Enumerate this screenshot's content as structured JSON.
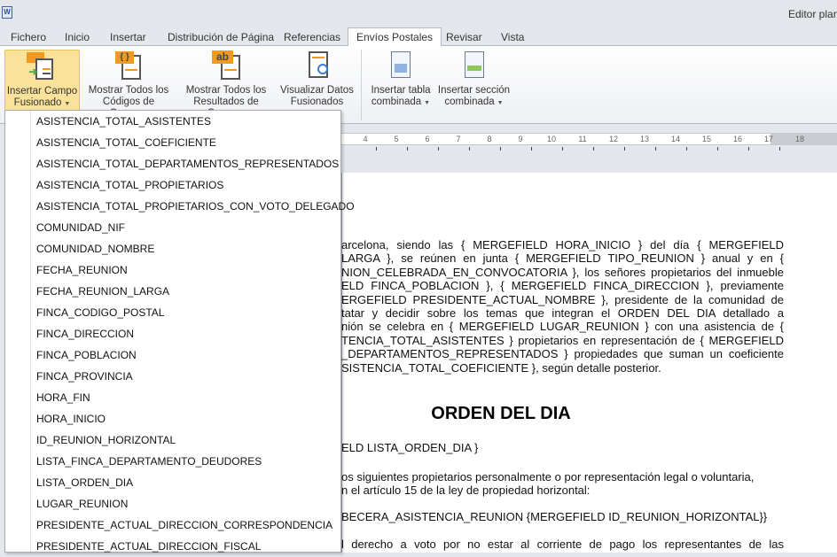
{
  "window": {
    "title": "Editor plant"
  },
  "tabs": [
    "Fichero",
    "Inicio",
    "Insertar",
    "Distribución de Página",
    "Referencias",
    "Envíos Postales",
    "Revisar",
    "Vista"
  ],
  "active_tab": "Envíos Postales",
  "ribbon": {
    "insert_field": {
      "line1": "Insertar Campo",
      "line2": "Fusionado"
    },
    "show_codes": {
      "line1": "Mostrar Todos los",
      "line2": "Códigos de Campos"
    },
    "show_results": {
      "line1": "Mostrar Todos los",
      "line2": "Resultados de Campos"
    },
    "preview": {
      "line1": "Visualizar Datos",
      "line2": "Fusionados"
    },
    "insert_table": {
      "line1": "Insertar tabla",
      "line2": "combinada"
    },
    "insert_section": {
      "line1": "Insertar sección",
      "line2": "combinada"
    },
    "icon_labels": {
      "codes": "{ }",
      "results": "ab"
    }
  },
  "ruler": {
    "numbers": [
      "4",
      "5",
      "6",
      "7",
      "8",
      "9",
      "10",
      "11",
      "12",
      "13",
      "14",
      "15",
      "16",
      "17",
      "18"
    ]
  },
  "merge_fields": [
    "ASISTENCIA_TOTAL_ASISTENTES",
    "ASISTENCIA_TOTAL_COEFICIENTE",
    "ASISTENCIA_TOTAL_DEPARTAMENTOS_REPRESENTADOS",
    "ASISTENCIA_TOTAL_PROPIETARIOS",
    "ASISTENCIA_TOTAL_PROPIETARIOS_CON_VOTO_DELEGADO",
    "COMUNIDAD_NIF",
    "COMUNIDAD_NOMBRE",
    "FECHA_REUNION",
    "FECHA_REUNION_LARGA",
    "FINCA_CODIGO_POSTAL",
    "FINCA_DIRECCION",
    "FINCA_POBLACION",
    "FINCA_PROVINCIA",
    "HORA_FIN",
    "HORA_INICIO",
    "ID_REUNION_HORIZONTAL",
    "LISTA_FINCA_DEPARTAMENTO_DEUDORES",
    "LISTA_ORDEN_DIA",
    "LUGAR_REUNION",
    "PRESIDENTE_ACTUAL_DIRECCION_CORRESPONDENCIA",
    "PRESIDENTE_ACTUAL_DIRECCION_FISCAL"
  ],
  "document": {
    "paragraph1": [
      "arcelona,  siendo  las  {  MERGEFIELD  HORA_INICIO  }  del  día  {  MERGEFIELD",
      "LARGA }, se reúnen en junta { MERGEFIELD TIPO_REUNION } anual y en {",
      "NION_CELEBRADA_EN_CONVOCATORIA }, los señores propietarios del inmueble",
      "ELD FINCA_POBLACION }, { MERGEFIELD FINCA_DIRECCION }, previamente",
      "ERGEFIELD PRESIDENTE_ACTUAL_NOMBRE }, presidente de la comunidad de",
      "tatar y decidir sobre los temas que integran el ORDEN DEL DIA detallado a",
      "nión se celebra en { MERGEFIELD LUGAR_REUNION } con una asistencia de {",
      "TENCIA_TOTAL_ASISTENTES } propietarios en representación de { MERGEFIELD",
      "_DEPARTAMENTOS_REPRESENTADOS } propiedades que suman un coeficiente",
      "SISTENCIA_TOTAL_COEFICIENTE }, según detalle posterior."
    ],
    "heading": "ORDEN DEL DIA",
    "line_lista": "ELD LISTA_ORDEN_DIA }",
    "paragraph2": [
      "os siguientes propietarios personalmente o por representación legal o voluntaria,",
      "n el artículo 15 de la ley de propiedad horizontal:"
    ],
    "line_cabecera": "BECERA_ASISTENCIA_REUNION {MERGEFIELD ID_REUNION_HORIZONTAL}}",
    "line_last": "l  derecho  a  voto  por  no  estar  al  corriente  de  pago  los  representantes  de  las"
  }
}
